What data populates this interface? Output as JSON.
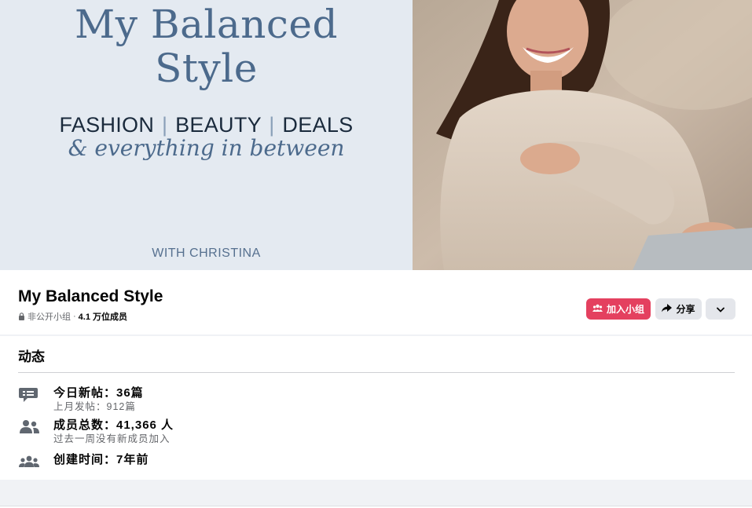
{
  "cover": {
    "title_line1": "My Balanced",
    "title_line2": "Style",
    "tagline_1": "FASHION",
    "tagline_sep": "|",
    "tagline_2": "BEAUTY",
    "tagline_3": "DEALS",
    "script": "& everything in between",
    "with": "WITH CHRISTINA"
  },
  "group": {
    "name": "My Balanced Style",
    "privacy": "非公开小组",
    "dot": "·",
    "members": "4.1 万位成员"
  },
  "actions": {
    "join_label": "加入小组",
    "share_label": "分享"
  },
  "activity": {
    "title": "动态",
    "rows": [
      {
        "icon": "chat-bubble-icon",
        "main": "今日新帖：36篇",
        "sub": "上月发帖：912篇"
      },
      {
        "icon": "members-icon",
        "main": "成员总数：41,366 人",
        "sub": "过去一周没有新成员加入"
      },
      {
        "icon": "group-created-icon",
        "main": "创建时间：7年前",
        "sub": ""
      }
    ]
  },
  "colors": {
    "join": "#e4405f",
    "secondary_button": "#e4e6eb",
    "cover_left": "#e4eaf1",
    "cover_text": "#4c6a8c"
  }
}
